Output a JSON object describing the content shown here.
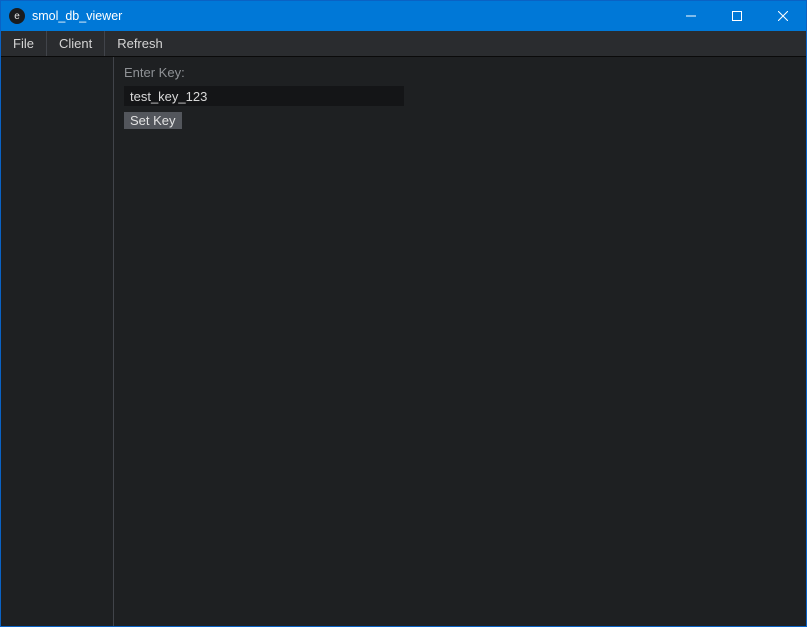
{
  "titlebar": {
    "icon_letter": "e",
    "title": "smol_db_viewer"
  },
  "menubar": {
    "items": [
      {
        "label": "File"
      },
      {
        "label": "Client"
      },
      {
        "label": "Refresh"
      }
    ]
  },
  "main": {
    "key_label": "Enter Key:",
    "key_value": "test_key_123",
    "set_key_button": "Set Key"
  }
}
